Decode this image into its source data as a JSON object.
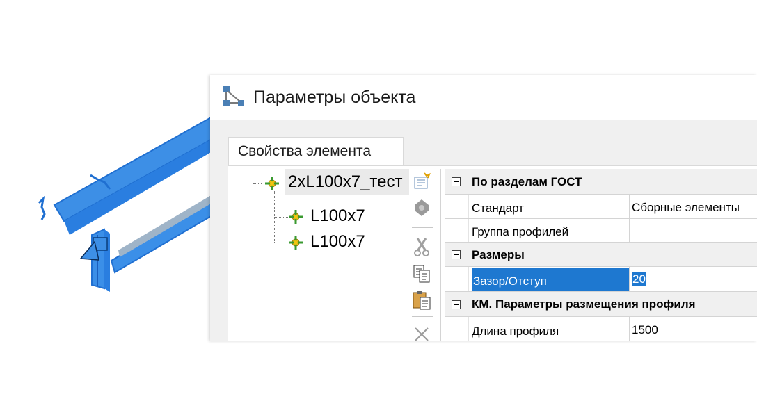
{
  "dialog": {
    "title": "Параметры объекта",
    "tab_label": "Свойства элемента"
  },
  "tree": {
    "root_label": "2xL100x7_тест",
    "children": [
      "L100x7",
      "L100x7"
    ]
  },
  "toolbar_icons": [
    "new-element-icon",
    "gear-icon",
    "cut-icon",
    "copy-icon",
    "paste-icon",
    "delete-icon"
  ],
  "properties": {
    "cat1": {
      "label": "По разделам ГОСТ"
    },
    "standard": {
      "label": "Стандарт",
      "value": "Сборные элементы"
    },
    "profile_group": {
      "label": "Группа профилей",
      "value": ""
    },
    "cat2": {
      "label": "Размеры"
    },
    "gap": {
      "label": "Зазор/Отступ",
      "value": "20"
    },
    "cat3": {
      "label": "КМ. Параметры размещения профиля"
    },
    "length": {
      "label": "Длина профиля",
      "value": "1500"
    }
  },
  "colors": {
    "model_blue": "#3d8fe6",
    "selection_blue": "#1e78d0",
    "tree_node_icon": "#f2c40f"
  }
}
